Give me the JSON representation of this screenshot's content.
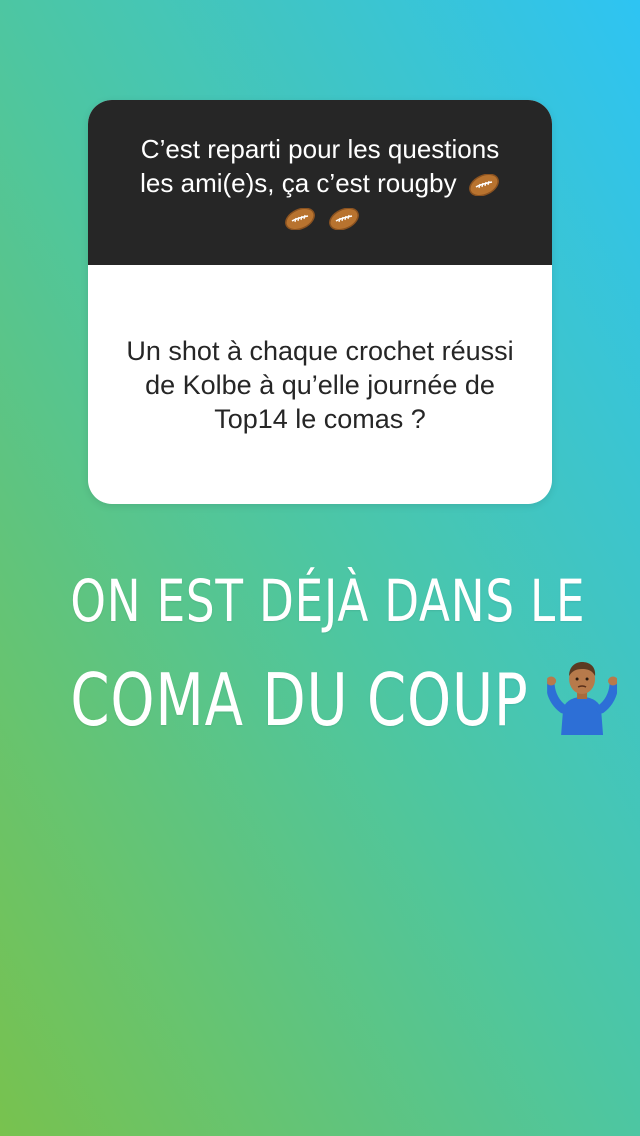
{
  "question_card": {
    "header_text": "C’est reparti pour les questions les ami(e)s, ça c’est rougby",
    "header_emojis": [
      "rugby-ball-icon",
      "rugby-ball-icon",
      "rugby-ball-icon"
    ],
    "answer_text": "Un shot à chaque crochet réussi de Kolbe à qu’elle journée de Top14 le comas ?"
  },
  "overlay_text": {
    "line1": "ON EST DÉJÀ DANS LE",
    "line2": "COMA DU COUP",
    "emoji": "person-shrugging-icon"
  },
  "colors": {
    "gradient_top_right": "#2ec4f3",
    "gradient_middle": "#4dc6a2",
    "gradient_bottom_left": "#78c24e",
    "card_header": "#262626",
    "card_body": "#ffffff"
  }
}
